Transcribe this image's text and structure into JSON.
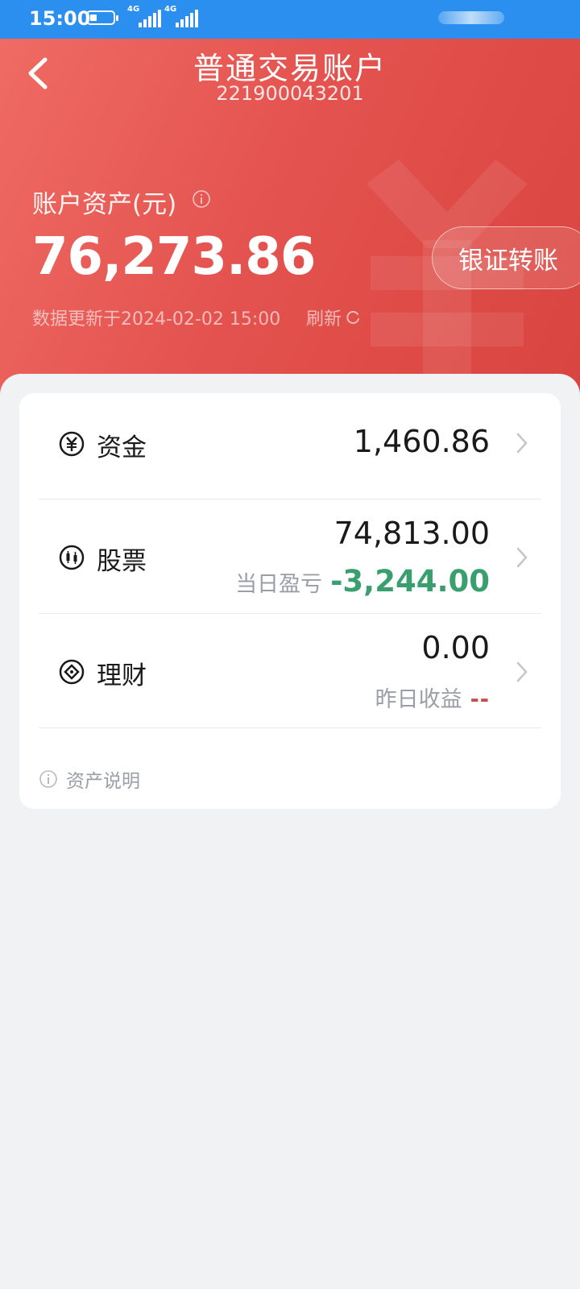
{
  "status_bar": {
    "time": "15:00",
    "network_1": "4G",
    "network_2": "4G"
  },
  "header": {
    "title": "普通交易账户",
    "account_number": "221900043201",
    "assets_label": "账户资产(元)",
    "assets_value": "76,273.86",
    "transfer_button": "银证转账",
    "update_text": "数据更新于2024-02-02 15:00",
    "refresh_label": "刷新"
  },
  "rows": {
    "cash": {
      "label": "资金",
      "value": "1,460.86",
      "icon": "yen-circle-icon"
    },
    "stocks": {
      "label": "股票",
      "value": "74,813.00",
      "sub_label": "当日盈亏",
      "sub_value": "-3,244.00",
      "icon": "candlestick-circle-icon"
    },
    "wealth": {
      "label": "理财",
      "value": "0.00",
      "sub_label": "昨日收益",
      "sub_value": "--",
      "icon": "diamond-circle-icon"
    }
  },
  "footer": {
    "note": "资产说明"
  },
  "colors": {
    "status_bar": "#2b8ff0",
    "header_red": "#e4534f",
    "loss_green": "#3a9f6e",
    "dash_red": "#c0504d",
    "page_bg": "#f1f2f3"
  }
}
